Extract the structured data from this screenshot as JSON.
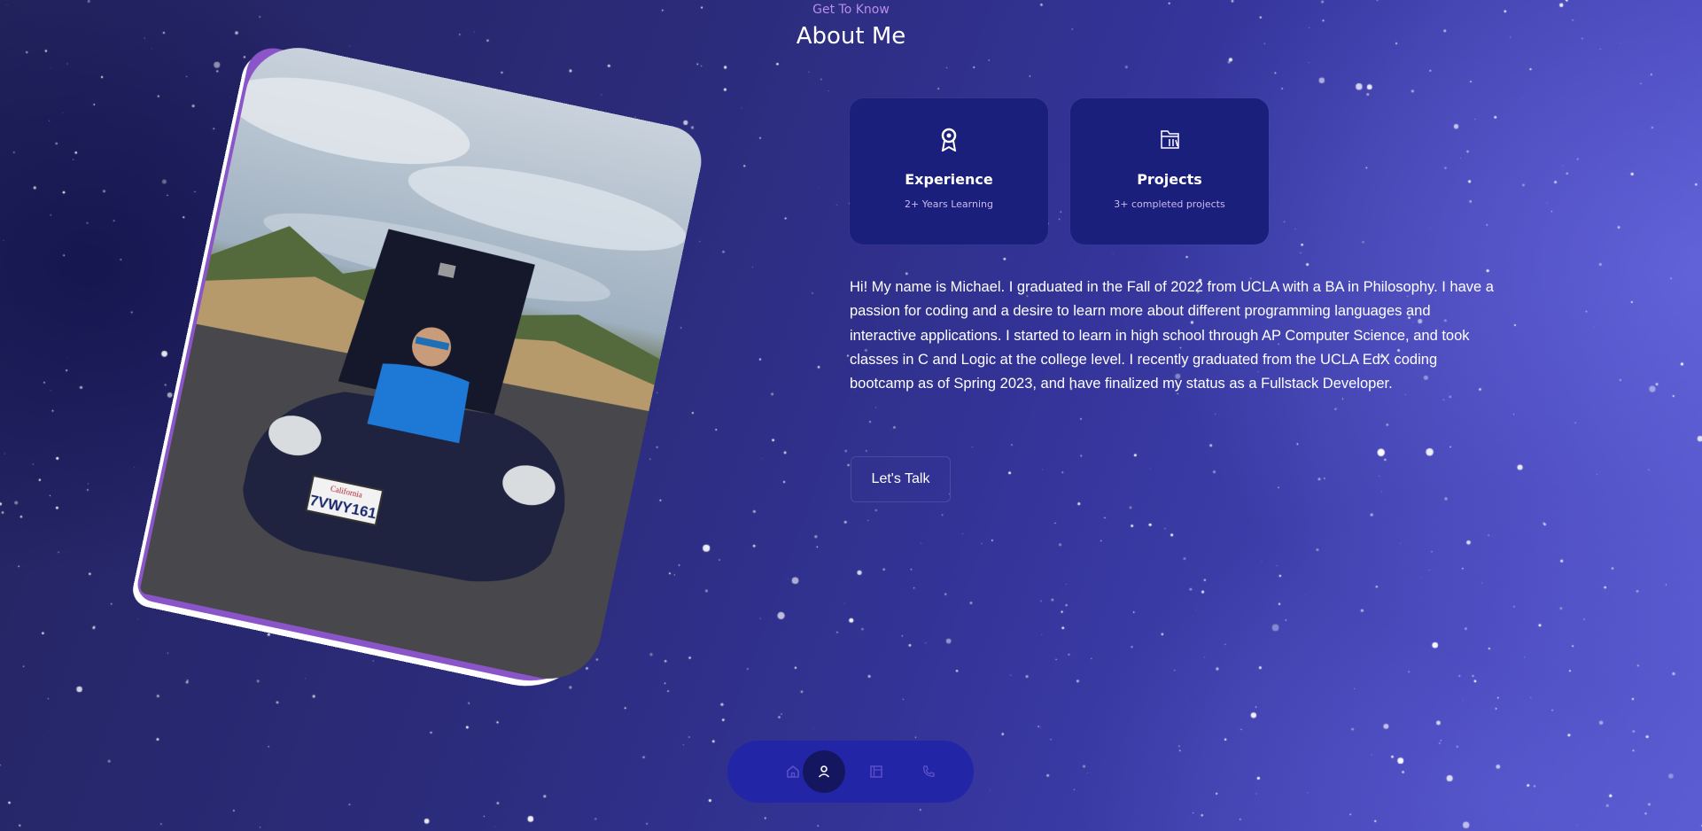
{
  "header": {
    "subtitle": "Get To Know",
    "title": "About Me"
  },
  "photo": {
    "alt": "Photo of Michael in the trunk of a dark blue sports car",
    "license_plate": "7VWY161",
    "plate_state": "California"
  },
  "cards": [
    {
      "icon": "award-icon",
      "title": "Experience",
      "subtitle": "2+ Years Learning"
    },
    {
      "icon": "folder-icon",
      "title": "Projects",
      "subtitle": "3+ completed projects"
    }
  ],
  "bio": "Hi! My name is Michael. I graduated in the Fall of 2022 from UCLA with a BA in Philosophy. I have a passion for coding and a desire to learn more about different programming languages and interactive applications. I started to learn in high school through AP Computer Science, and took classes in C and Logic at the college level. I recently graduated from the UCLA EdX coding bootcamp as of Spring 2023, and have finalized my status as a Fullstack Developer.",
  "cta": {
    "label": "Let's Talk"
  },
  "nav": {
    "items": [
      {
        "icon": "home-icon",
        "active": false
      },
      {
        "icon": "user-icon",
        "active": true
      },
      {
        "icon": "book-icon",
        "active": false
      },
      {
        "icon": "phone-icon",
        "active": false
      }
    ]
  },
  "colors": {
    "card_bg": "#1b1f7c",
    "nav_bg": "#2226a6",
    "nav_active": "#151660",
    "accent": "#b98ee8"
  }
}
